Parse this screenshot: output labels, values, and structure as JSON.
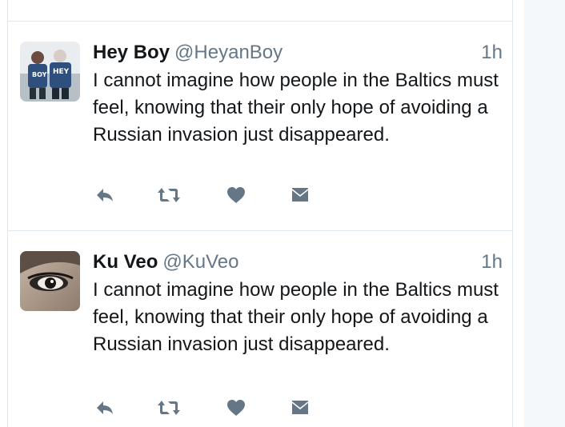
{
  "colors": {
    "text_primary": "#14171a",
    "text_secondary": "#657786",
    "divider": "#e1e8ed",
    "action_icon": "#657786",
    "side_panel": "#f5f8fa"
  },
  "tweets": [
    {
      "display_name": "Hey Boy",
      "handle": "@HeyanBoy",
      "timestamp": "1h",
      "text": "I cannot imagine how people in the Baltics must feel, knowing that their only hope of avoiding a Russian invasion just disappeared.",
      "avatar_shirt_text_left": "BOY",
      "avatar_shirt_text_right": "HEY",
      "actions": [
        "reply-icon",
        "retweet-icon",
        "like-icon",
        "direct-message-icon"
      ]
    },
    {
      "display_name": "Ku Veo",
      "handle": "@KuVeo",
      "timestamp": "1h",
      "text": "I cannot imagine how people in the Baltics must feel, knowing that their only hope of avoiding a Russian invasion just disappeared.",
      "actions": [
        "reply-icon",
        "retweet-icon",
        "like-icon",
        "direct-message-icon"
      ]
    }
  ]
}
